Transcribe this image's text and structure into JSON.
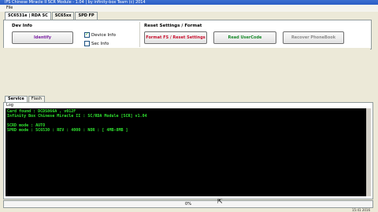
{
  "window": {
    "title": "IFS Chinese Miracle II SCR Module - 1.04 | by infinity-box Team (c) 2014",
    "menu": [
      "File"
    ]
  },
  "tabs": [
    "SC6531e | RDA SC",
    "SC65xx",
    "SPD FP"
  ],
  "dev_info": {
    "title": "Dev Info",
    "identify_label": "Identify",
    "device_info_label": "Device Info",
    "device_info_checked": true,
    "sec_info_label": "Sec Info",
    "sec_info_checked": false
  },
  "reset": {
    "title": "Reset Settings / Format",
    "format_label": "Format FS / Reset Settings",
    "read_usercode_label": "Read UserCode",
    "recover_phonebook_label": "Recover PhoneBook"
  },
  "bottom_tabs": [
    "Service",
    "Flash"
  ],
  "log": {
    "label": "Log",
    "lines": [
      "Card found : DCDS866A , v012F",
      "Infinity Box Chinese Miracle II : SC/RDA Module [SCR] v1.04",
      "",
      "SCRD mode : AUTO",
      "SPRD mode : SC6530 : REV : 4000 : NOR : [ 4MB-8MB ]"
    ]
  },
  "progress": {
    "text": "0%",
    "value": 0
  },
  "status": {
    "left": "",
    "right": "15:41 2016"
  },
  "colors": {
    "identify": "#7a1fa2",
    "format": "#c8102e",
    "read_usercode": "#1a8a2c",
    "recover_phonebook": "#8c8c8c",
    "console_text": "#2fe02f"
  }
}
